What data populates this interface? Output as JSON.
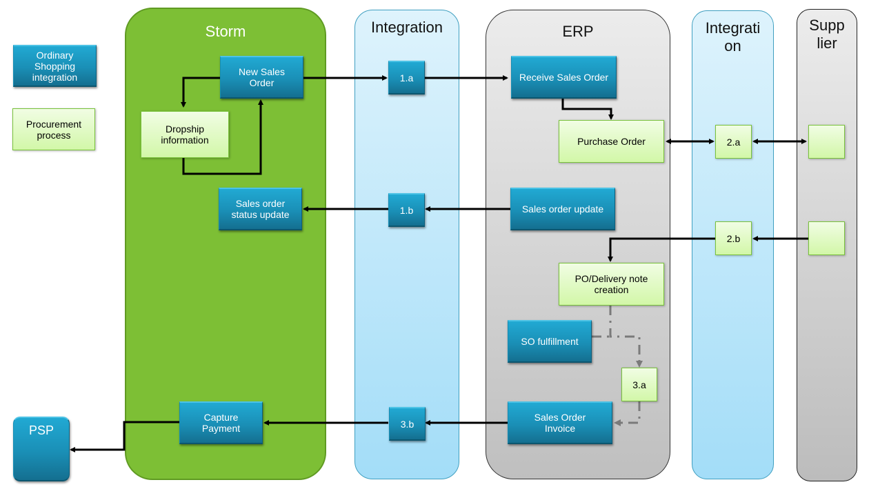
{
  "legend": {
    "ordinary": "Ordinary Shopping integration",
    "procurement": "Procurement process"
  },
  "lanes": {
    "storm": "Storm",
    "integration": "Integration",
    "erp": "ERP",
    "integration2_line1": "Integrati",
    "integration2_line2": "on",
    "supplier_line1": "Supp",
    "supplier_line2": "lier"
  },
  "nodes": {
    "new_sales_order": "New Sales Order",
    "dropship_information": "Dropship information",
    "sales_order_status_update": "Sales order status update",
    "capture_payment": "Capture Payment",
    "psp": "PSP",
    "step_1a": "1.a",
    "step_1b": "1.b",
    "step_3b": "3.b",
    "receive_sales_order": "Receive Sales Order",
    "purchase_order": "Purchase Order",
    "sales_order_update": "Sales order update",
    "po_delivery_note_creation": "PO/Delivery note creation",
    "so_fulfillment": "SO fulfillment",
    "step_3a": "3.a",
    "sales_order_invoice": "Sales Order Invoice",
    "step_2a": "2.a",
    "step_2b": "2.b",
    "supplier_box_1": "",
    "supplier_box_2": ""
  },
  "colors": {
    "storm_lane": "#7dbf35",
    "integration_lane": "#bfe8fb",
    "erp_lane": "#d6d6d6",
    "blue_box": "#1a8fb6",
    "green_box": "#d9f7b4"
  }
}
